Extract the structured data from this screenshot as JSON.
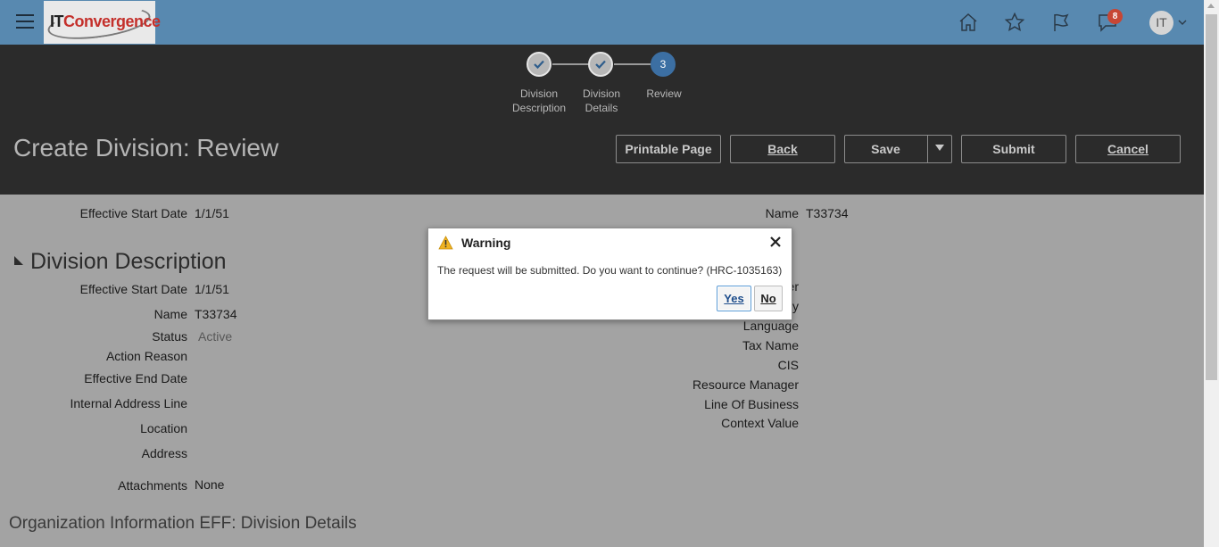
{
  "header": {
    "logo": {
      "it": "IT",
      "convergence": "Convergence"
    },
    "notification_count": "8",
    "user_initials": "IT"
  },
  "train": {
    "stops": [
      {
        "label_line1": "Division",
        "label_line2": "Description",
        "state": "done"
      },
      {
        "label_line1": "Division",
        "label_line2": "Details",
        "state": "done"
      },
      {
        "label_line1": "Review",
        "label_line2": "",
        "state": "current",
        "number": "3"
      }
    ]
  },
  "page": {
    "title": "Create Division: Review",
    "buttons": {
      "printable": "Printable Page",
      "back": "Back",
      "save": "Save",
      "submit": "Submit",
      "cancel": "Cancel"
    }
  },
  "summary": {
    "effective_start_date_label": "Effective Start Date",
    "effective_start_date_value": "1/1/51",
    "name_label": "Name",
    "name_value": "T33734"
  },
  "division_description": {
    "section_title": "Division Description",
    "left_fields": [
      {
        "label": "Effective Start Date",
        "value": "1/1/51"
      },
      {
        "label": "Name",
        "value": "T33734"
      },
      {
        "label": "Status",
        "value": "Active"
      },
      {
        "label": "Action Reason",
        "value": ""
      },
      {
        "label": "Effective End Date",
        "value": ""
      },
      {
        "label": "Internal Address Line",
        "value": ""
      },
      {
        "label": "Location",
        "value": ""
      },
      {
        "label": "Address",
        "value": ""
      },
      {
        "label": "Attachments",
        "value": "None"
      }
    ],
    "right_fields": [
      {
        "label": "er",
        "value": ""
      },
      {
        "label": "y",
        "value": ""
      },
      {
        "label": "Language",
        "value": ""
      },
      {
        "label": "Tax Name",
        "value": ""
      },
      {
        "label": "CIS",
        "value": ""
      },
      {
        "label": "Resource Manager",
        "value": ""
      },
      {
        "label": "Line Of Business",
        "value": ""
      },
      {
        "label": "Context Value",
        "value": ""
      }
    ]
  },
  "eff_section": {
    "title": "Organization Information EFF: Division Details"
  },
  "dialog": {
    "title": "Warning",
    "message": "The request will be submitted. Do you want to continue? (HRC-1035163)",
    "yes": "Yes",
    "no": "No"
  },
  "colors": {
    "header_bg": "#5889b0",
    "band_bg": "#2b2b2b",
    "overlay_bg": "#a3a3a3",
    "current_stop": "#3c6fa3",
    "badge": "#c74634",
    "logo_red": "#c4302b"
  }
}
